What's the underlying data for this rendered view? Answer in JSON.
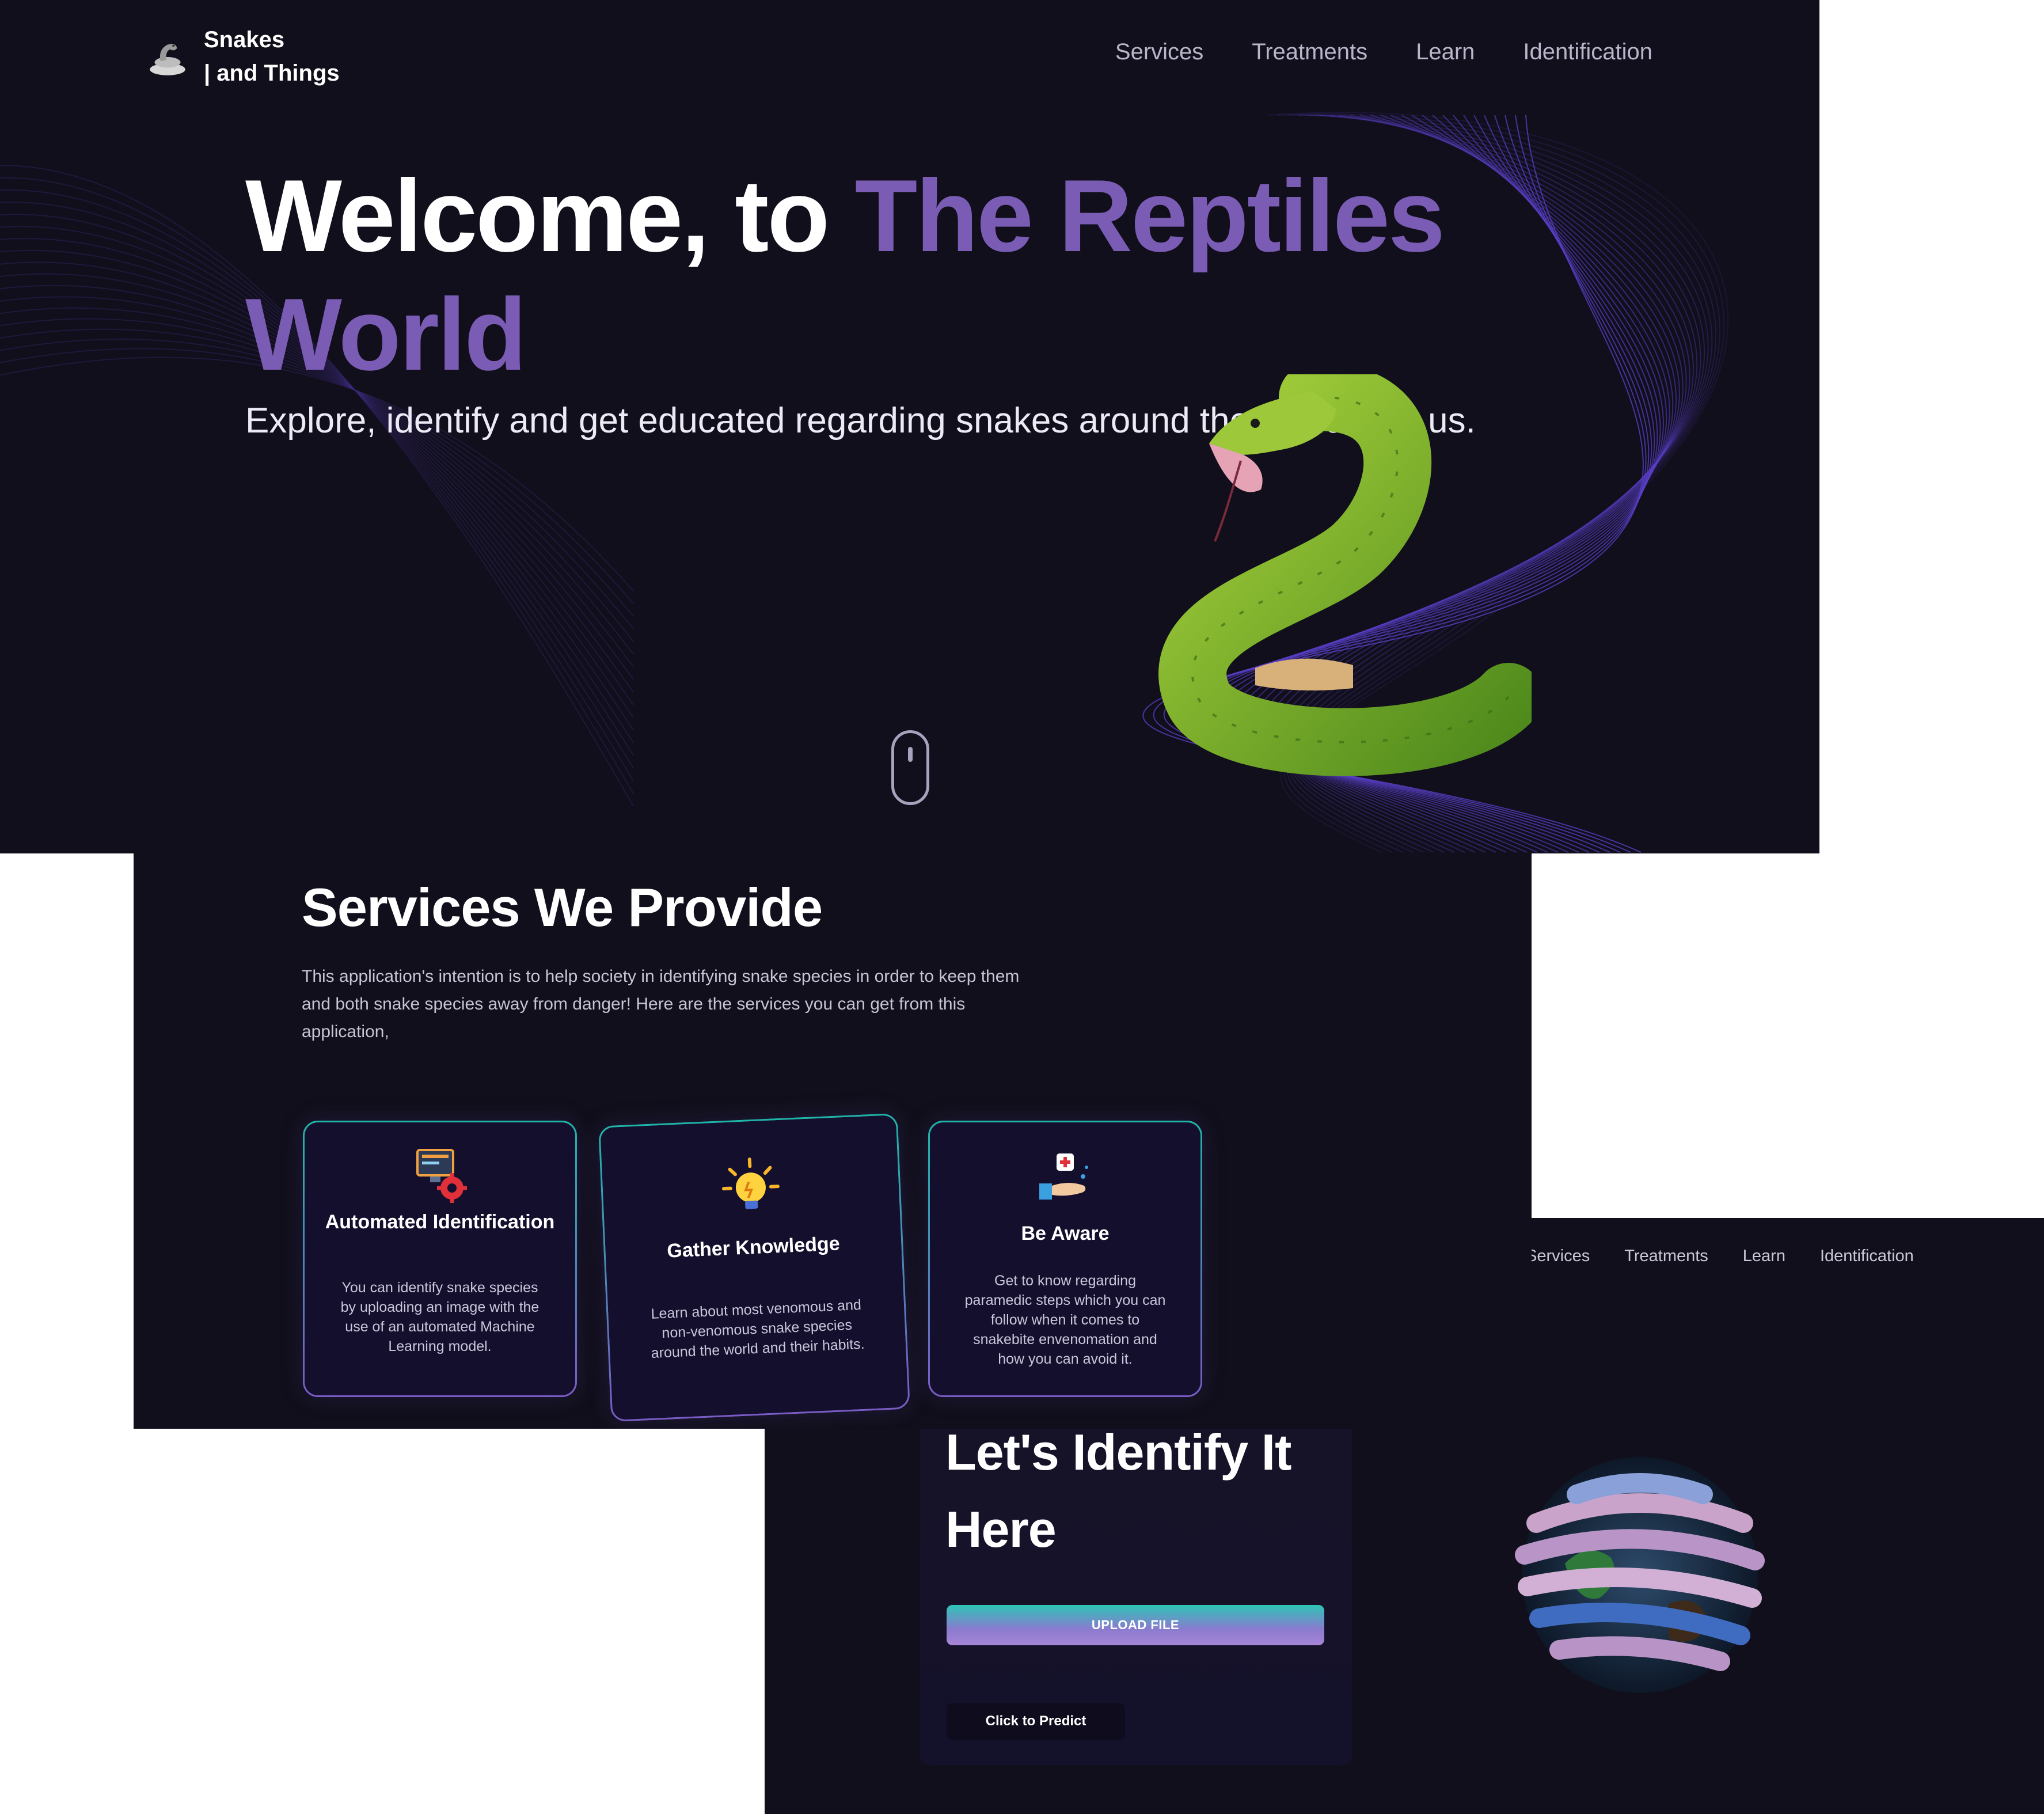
{
  "hero": {
    "logo_text": "Snakes\n| and Things",
    "nav": [
      "Services",
      "Treatments",
      "Learn",
      "Identification"
    ],
    "title_white": "Welcome, to ",
    "title_accent": "The Reptiles World",
    "subtitle": "Explore, identify and get educated regarding snakes around the world with us.",
    "subtitle_visible_left": "Explore, identify and get educated regarding",
    "subtitle_visible_right": "around the",
    "subtitle_line2": "world with us."
  },
  "services": {
    "title": "Services We Provide",
    "description": "This application's intention is to help society in identifying snake species in order to keep them and both snake species away from danger! Here are the services you can get from this application,",
    "cards": [
      {
        "icon": "automation-icon",
        "title": "Automated Identification",
        "text": "You can identify snake species by uploading an image with the use of an automated Machine Learning model."
      },
      {
        "icon": "lightbulb-icon",
        "title": "Gather Knowledge",
        "text": "Learn about most venomous and non-venomous snake species around the world and their habits."
      },
      {
        "icon": "first-aid-hand-icon",
        "title": "Be Aware",
        "text": "Get to know regarding paramedic steps which you can follow when it comes to snakebite envenomation and how you can avoid it."
      }
    ]
  },
  "identify": {
    "nav": [
      "Services",
      "Treatments",
      "Learn",
      "Identification"
    ],
    "title": "Let's Identify It Here",
    "upload_label": "UPLOAD FILE",
    "predict_label": "Click to Predict"
  },
  "colors": {
    "background": "#110f1b",
    "accent_purple": "#7a5cb5",
    "teal": "#2ec4b6",
    "snake_green": "#8fbf2a"
  }
}
